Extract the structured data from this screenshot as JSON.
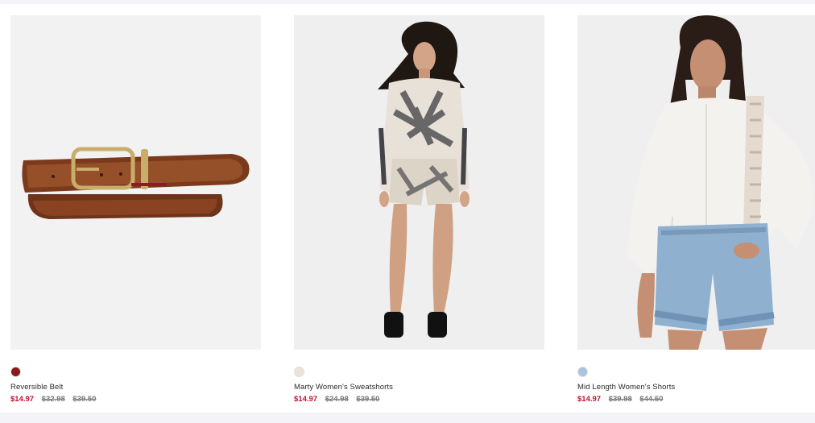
{
  "products": [
    {
      "name": "Reversible Belt",
      "swatch_color": "#8b1a1a",
      "image_icon": "belt-image",
      "prices": {
        "sale": "$14.97",
        "compare1": "$32.98",
        "compare2": "$39.50"
      }
    },
    {
      "name": "Marty Women's Sweatshorts",
      "swatch_color": "#ece2d6",
      "image_icon": "sweatshorts-model-image",
      "prices": {
        "sale": "$14.97",
        "compare1": "$24.98",
        "compare2": "$39.50"
      }
    },
    {
      "name": "Mid Length Women's Shorts",
      "swatch_color": "#a9c4de",
      "image_icon": "denim-shorts-model-image",
      "prices": {
        "sale": "$14.97",
        "compare1": "$39.98",
        "compare2": "$44.50"
      }
    }
  ],
  "colors": {
    "sale": "#c41230",
    "strike": "#7a7a7a",
    "page_bg": "#f3f3f8",
    "card_bg": "#ffffff"
  }
}
